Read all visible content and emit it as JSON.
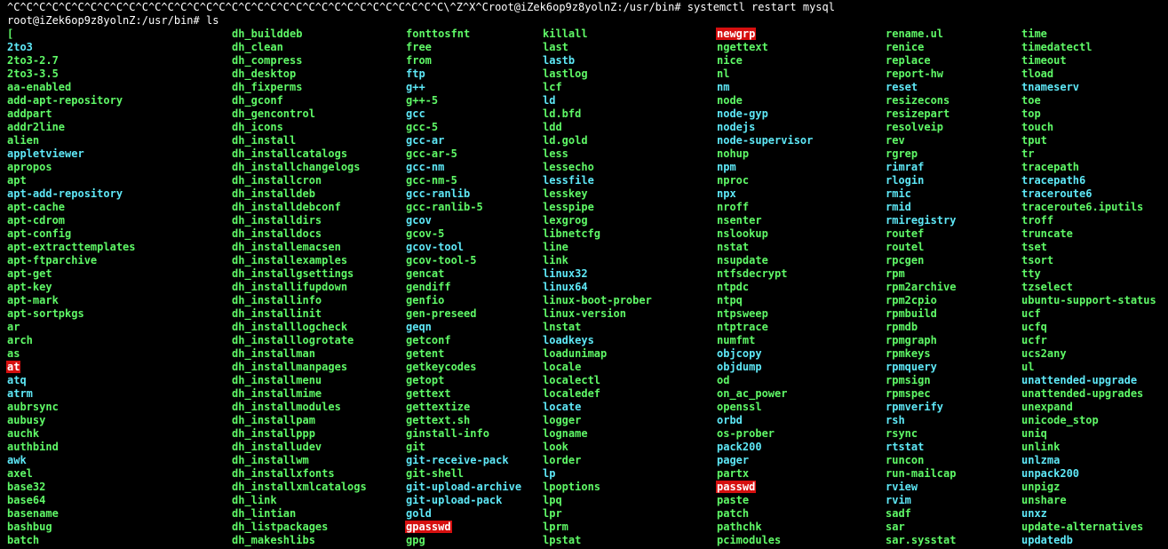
{
  "theme": {
    "background": "#000000",
    "text": "#ffffff",
    "executable": "#5ff967",
    "symlink": "#5ee8f7",
    "setuid_bg": "#d60f0f",
    "setuid_fg": "#ffffff"
  },
  "terminal": {
    "lines": [
      "^C^C^C^C^C^C^C^C^C^C^C^C^C^C^C^C^C^C^C^C^C^C^C^C^C^C^C^C^C^C^C^C^C^C\\^Z^X^Croot@iZek6op9z8yolnZ:/usr/bin# systemctl restart mysql",
      "root@iZek6op9z8yolnZ:/usr/bin# ls"
    ],
    "columns": [
      [
        {
          "n": "[",
          "t": "e"
        },
        {
          "n": "2to3",
          "t": "l"
        },
        {
          "n": "2to3-2.7",
          "t": "e"
        },
        {
          "n": "2to3-3.5",
          "t": "e"
        },
        {
          "n": "aa-enabled",
          "t": "e"
        },
        {
          "n": "add-apt-repository",
          "t": "e"
        },
        {
          "n": "addpart",
          "t": "e"
        },
        {
          "n": "addr2line",
          "t": "e"
        },
        {
          "n": "alien",
          "t": "e"
        },
        {
          "n": "appletviewer",
          "t": "l"
        },
        {
          "n": "apropos",
          "t": "e"
        },
        {
          "n": "apt",
          "t": "e"
        },
        {
          "n": "apt-add-repository",
          "t": "l"
        },
        {
          "n": "apt-cache",
          "t": "e"
        },
        {
          "n": "apt-cdrom",
          "t": "e"
        },
        {
          "n": "apt-config",
          "t": "e"
        },
        {
          "n": "apt-extracttemplates",
          "t": "e"
        },
        {
          "n": "apt-ftparchive",
          "t": "e"
        },
        {
          "n": "apt-get",
          "t": "e"
        },
        {
          "n": "apt-key",
          "t": "e"
        },
        {
          "n": "apt-mark",
          "t": "e"
        },
        {
          "n": "apt-sortpkgs",
          "t": "e"
        },
        {
          "n": "ar",
          "t": "e"
        },
        {
          "n": "arch",
          "t": "e"
        },
        {
          "n": "as",
          "t": "e"
        },
        {
          "n": "at",
          "t": "s"
        },
        {
          "n": "atq",
          "t": "l"
        },
        {
          "n": "atrm",
          "t": "l"
        },
        {
          "n": "aubrsync",
          "t": "e"
        },
        {
          "n": "aubusy",
          "t": "e"
        },
        {
          "n": "auchk",
          "t": "e"
        },
        {
          "n": "authbind",
          "t": "e"
        },
        {
          "n": "awk",
          "t": "l"
        },
        {
          "n": "axel",
          "t": "e"
        },
        {
          "n": "base32",
          "t": "e"
        },
        {
          "n": "base64",
          "t": "e"
        },
        {
          "n": "basename",
          "t": "e"
        },
        {
          "n": "bashbug",
          "t": "e"
        },
        {
          "n": "batch",
          "t": "e"
        }
      ],
      [
        {
          "n": "dh_builddeb",
          "t": "e"
        },
        {
          "n": "dh_clean",
          "t": "e"
        },
        {
          "n": "dh_compress",
          "t": "e"
        },
        {
          "n": "dh_desktop",
          "t": "e"
        },
        {
          "n": "dh_fixperms",
          "t": "e"
        },
        {
          "n": "dh_gconf",
          "t": "e"
        },
        {
          "n": "dh_gencontrol",
          "t": "e"
        },
        {
          "n": "dh_icons",
          "t": "e"
        },
        {
          "n": "dh_install",
          "t": "e"
        },
        {
          "n": "dh_installcatalogs",
          "t": "e"
        },
        {
          "n": "dh_installchangelogs",
          "t": "e"
        },
        {
          "n": "dh_installcron",
          "t": "e"
        },
        {
          "n": "dh_installdeb",
          "t": "e"
        },
        {
          "n": "dh_installdebconf",
          "t": "e"
        },
        {
          "n": "dh_installdirs",
          "t": "e"
        },
        {
          "n": "dh_installdocs",
          "t": "e"
        },
        {
          "n": "dh_installemacsen",
          "t": "e"
        },
        {
          "n": "dh_installexamples",
          "t": "e"
        },
        {
          "n": "dh_installgsettings",
          "t": "e"
        },
        {
          "n": "dh_installifupdown",
          "t": "e"
        },
        {
          "n": "dh_installinfo",
          "t": "e"
        },
        {
          "n": "dh_installinit",
          "t": "e"
        },
        {
          "n": "dh_installlogcheck",
          "t": "e"
        },
        {
          "n": "dh_installlogrotate",
          "t": "e"
        },
        {
          "n": "dh_installman",
          "t": "e"
        },
        {
          "n": "dh_installmanpages",
          "t": "e"
        },
        {
          "n": "dh_installmenu",
          "t": "e"
        },
        {
          "n": "dh_installmime",
          "t": "e"
        },
        {
          "n": "dh_installmodules",
          "t": "e"
        },
        {
          "n": "dh_installpam",
          "t": "e"
        },
        {
          "n": "dh_installppp",
          "t": "e"
        },
        {
          "n": "dh_installudev",
          "t": "e"
        },
        {
          "n": "dh_installwm",
          "t": "e"
        },
        {
          "n": "dh_installxfonts",
          "t": "e"
        },
        {
          "n": "dh_installxmlcatalogs",
          "t": "e"
        },
        {
          "n": "dh_link",
          "t": "e"
        },
        {
          "n": "dh_lintian",
          "t": "e"
        },
        {
          "n": "dh_listpackages",
          "t": "e"
        },
        {
          "n": "dh_makeshlibs",
          "t": "e"
        }
      ],
      [
        {
          "n": "fonttosfnt",
          "t": "e"
        },
        {
          "n": "free",
          "t": "e"
        },
        {
          "n": "from",
          "t": "e"
        },
        {
          "n": "ftp",
          "t": "l"
        },
        {
          "n": "g++",
          "t": "l"
        },
        {
          "n": "g++-5",
          "t": "e"
        },
        {
          "n": "gcc",
          "t": "l"
        },
        {
          "n": "gcc-5",
          "t": "e"
        },
        {
          "n": "gcc-ar",
          "t": "l"
        },
        {
          "n": "gcc-ar-5",
          "t": "e"
        },
        {
          "n": "gcc-nm",
          "t": "l"
        },
        {
          "n": "gcc-nm-5",
          "t": "e"
        },
        {
          "n": "gcc-ranlib",
          "t": "l"
        },
        {
          "n": "gcc-ranlib-5",
          "t": "e"
        },
        {
          "n": "gcov",
          "t": "l"
        },
        {
          "n": "gcov-5",
          "t": "e"
        },
        {
          "n": "gcov-tool",
          "t": "l"
        },
        {
          "n": "gcov-tool-5",
          "t": "e"
        },
        {
          "n": "gencat",
          "t": "e"
        },
        {
          "n": "gendiff",
          "t": "e"
        },
        {
          "n": "genfio",
          "t": "e"
        },
        {
          "n": "gen-preseed",
          "t": "e"
        },
        {
          "n": "geqn",
          "t": "l"
        },
        {
          "n": "getconf",
          "t": "e"
        },
        {
          "n": "getent",
          "t": "e"
        },
        {
          "n": "getkeycodes",
          "t": "e"
        },
        {
          "n": "getopt",
          "t": "e"
        },
        {
          "n": "gettext",
          "t": "e"
        },
        {
          "n": "gettextize",
          "t": "e"
        },
        {
          "n": "gettext.sh",
          "t": "e"
        },
        {
          "n": "ginstall-info",
          "t": "e"
        },
        {
          "n": "git",
          "t": "e"
        },
        {
          "n": "git-receive-pack",
          "t": "l"
        },
        {
          "n": "git-shell",
          "t": "e"
        },
        {
          "n": "git-upload-archive",
          "t": "l"
        },
        {
          "n": "git-upload-pack",
          "t": "l"
        },
        {
          "n": "gold",
          "t": "l"
        },
        {
          "n": "gpasswd",
          "t": "s"
        },
        {
          "n": "gpg",
          "t": "e"
        }
      ],
      [
        {
          "n": "killall",
          "t": "e"
        },
        {
          "n": "last",
          "t": "e"
        },
        {
          "n": "lastb",
          "t": "l"
        },
        {
          "n": "lastlog",
          "t": "e"
        },
        {
          "n": "lcf",
          "t": "e"
        },
        {
          "n": "ld",
          "t": "l"
        },
        {
          "n": "ld.bfd",
          "t": "e"
        },
        {
          "n": "ldd",
          "t": "e"
        },
        {
          "n": "ld.gold",
          "t": "e"
        },
        {
          "n": "less",
          "t": "e"
        },
        {
          "n": "lessecho",
          "t": "e"
        },
        {
          "n": "lessfile",
          "t": "l"
        },
        {
          "n": "lesskey",
          "t": "e"
        },
        {
          "n": "lesspipe",
          "t": "e"
        },
        {
          "n": "lexgrog",
          "t": "e"
        },
        {
          "n": "libnetcfg",
          "t": "e"
        },
        {
          "n": "line",
          "t": "e"
        },
        {
          "n": "link",
          "t": "e"
        },
        {
          "n": "linux32",
          "t": "l"
        },
        {
          "n": "linux64",
          "t": "l"
        },
        {
          "n": "linux-boot-prober",
          "t": "e"
        },
        {
          "n": "linux-version",
          "t": "e"
        },
        {
          "n": "lnstat",
          "t": "e"
        },
        {
          "n": "loadkeys",
          "t": "l"
        },
        {
          "n": "loadunimap",
          "t": "e"
        },
        {
          "n": "locale",
          "t": "e"
        },
        {
          "n": "localectl",
          "t": "e"
        },
        {
          "n": "localedef",
          "t": "e"
        },
        {
          "n": "locate",
          "t": "l"
        },
        {
          "n": "logger",
          "t": "e"
        },
        {
          "n": "logname",
          "t": "e"
        },
        {
          "n": "look",
          "t": "e"
        },
        {
          "n": "lorder",
          "t": "e"
        },
        {
          "n": "lp",
          "t": "l"
        },
        {
          "n": "lpoptions",
          "t": "e"
        },
        {
          "n": "lpq",
          "t": "e"
        },
        {
          "n": "lpr",
          "t": "e"
        },
        {
          "n": "lprm",
          "t": "e"
        },
        {
          "n": "lpstat",
          "t": "e"
        }
      ],
      [
        {
          "n": "newgrp",
          "t": "s"
        },
        {
          "n": "ngettext",
          "t": "e"
        },
        {
          "n": "nice",
          "t": "e"
        },
        {
          "n": "nl",
          "t": "e"
        },
        {
          "n": "nm",
          "t": "l"
        },
        {
          "n": "node",
          "t": "e"
        },
        {
          "n": "node-gyp",
          "t": "l"
        },
        {
          "n": "nodejs",
          "t": "l"
        },
        {
          "n": "node-supervisor",
          "t": "l"
        },
        {
          "n": "nohup",
          "t": "e"
        },
        {
          "n": "npm",
          "t": "l"
        },
        {
          "n": "nproc",
          "t": "e"
        },
        {
          "n": "npx",
          "t": "l"
        },
        {
          "n": "nroff",
          "t": "e"
        },
        {
          "n": "nsenter",
          "t": "e"
        },
        {
          "n": "nslookup",
          "t": "e"
        },
        {
          "n": "nstat",
          "t": "e"
        },
        {
          "n": "nsupdate",
          "t": "e"
        },
        {
          "n": "ntfsdecrypt",
          "t": "e"
        },
        {
          "n": "ntpdc",
          "t": "e"
        },
        {
          "n": "ntpq",
          "t": "e"
        },
        {
          "n": "ntpsweep",
          "t": "e"
        },
        {
          "n": "ntptrace",
          "t": "e"
        },
        {
          "n": "numfmt",
          "t": "e"
        },
        {
          "n": "objcopy",
          "t": "l"
        },
        {
          "n": "objdump",
          "t": "l"
        },
        {
          "n": "od",
          "t": "e"
        },
        {
          "n": "on_ac_power",
          "t": "e"
        },
        {
          "n": "openssl",
          "t": "e"
        },
        {
          "n": "orbd",
          "t": "l"
        },
        {
          "n": "os-prober",
          "t": "e"
        },
        {
          "n": "pack200",
          "t": "l"
        },
        {
          "n": "pager",
          "t": "l"
        },
        {
          "n": "partx",
          "t": "e"
        },
        {
          "n": "passwd",
          "t": "s"
        },
        {
          "n": "paste",
          "t": "e"
        },
        {
          "n": "patch",
          "t": "e"
        },
        {
          "n": "pathchk",
          "t": "e"
        },
        {
          "n": "pcimodules",
          "t": "e"
        }
      ],
      [
        {
          "n": "rename.ul",
          "t": "e"
        },
        {
          "n": "renice",
          "t": "e"
        },
        {
          "n": "replace",
          "t": "e"
        },
        {
          "n": "report-hw",
          "t": "e"
        },
        {
          "n": "reset",
          "t": "l"
        },
        {
          "n": "resizecons",
          "t": "e"
        },
        {
          "n": "resizepart",
          "t": "e"
        },
        {
          "n": "resolveip",
          "t": "e"
        },
        {
          "n": "rev",
          "t": "e"
        },
        {
          "n": "rgrep",
          "t": "e"
        },
        {
          "n": "rimraf",
          "t": "l"
        },
        {
          "n": "rlogin",
          "t": "l"
        },
        {
          "n": "rmic",
          "t": "l"
        },
        {
          "n": "rmid",
          "t": "l"
        },
        {
          "n": "rmiregistry",
          "t": "l"
        },
        {
          "n": "routef",
          "t": "e"
        },
        {
          "n": "routel",
          "t": "e"
        },
        {
          "n": "rpcgen",
          "t": "e"
        },
        {
          "n": "rpm",
          "t": "e"
        },
        {
          "n": "rpm2archive",
          "t": "e"
        },
        {
          "n": "rpm2cpio",
          "t": "e"
        },
        {
          "n": "rpmbuild",
          "t": "e"
        },
        {
          "n": "rpmdb",
          "t": "e"
        },
        {
          "n": "rpmgraph",
          "t": "e"
        },
        {
          "n": "rpmkeys",
          "t": "e"
        },
        {
          "n": "rpmquery",
          "t": "l"
        },
        {
          "n": "rpmsign",
          "t": "e"
        },
        {
          "n": "rpmspec",
          "t": "e"
        },
        {
          "n": "rpmverify",
          "t": "l"
        },
        {
          "n": "rsh",
          "t": "l"
        },
        {
          "n": "rsync",
          "t": "e"
        },
        {
          "n": "rtstat",
          "t": "l"
        },
        {
          "n": "runcon",
          "t": "e"
        },
        {
          "n": "run-mailcap",
          "t": "e"
        },
        {
          "n": "rview",
          "t": "l"
        },
        {
          "n": "rvim",
          "t": "l"
        },
        {
          "n": "sadf",
          "t": "e"
        },
        {
          "n": "sar",
          "t": "e"
        },
        {
          "n": "sar.sysstat",
          "t": "e"
        }
      ],
      [
        {
          "n": "time",
          "t": "e"
        },
        {
          "n": "timedatectl",
          "t": "e"
        },
        {
          "n": "timeout",
          "t": "e"
        },
        {
          "n": "tload",
          "t": "e"
        },
        {
          "n": "tnameserv",
          "t": "l"
        },
        {
          "n": "toe",
          "t": "e"
        },
        {
          "n": "top",
          "t": "e"
        },
        {
          "n": "touch",
          "t": "e"
        },
        {
          "n": "tput",
          "t": "e"
        },
        {
          "n": "tr",
          "t": "e"
        },
        {
          "n": "tracepath",
          "t": "e"
        },
        {
          "n": "tracepath6",
          "t": "l"
        },
        {
          "n": "traceroute6",
          "t": "l"
        },
        {
          "n": "traceroute6.iputils",
          "t": "e"
        },
        {
          "n": "troff",
          "t": "e"
        },
        {
          "n": "truncate",
          "t": "e"
        },
        {
          "n": "tset",
          "t": "e"
        },
        {
          "n": "tsort",
          "t": "e"
        },
        {
          "n": "tty",
          "t": "e"
        },
        {
          "n": "tzselect",
          "t": "e"
        },
        {
          "n": "ubuntu-support-status",
          "t": "e"
        },
        {
          "n": "ucf",
          "t": "e"
        },
        {
          "n": "ucfq",
          "t": "e"
        },
        {
          "n": "ucfr",
          "t": "e"
        },
        {
          "n": "ucs2any",
          "t": "e"
        },
        {
          "n": "ul",
          "t": "e"
        },
        {
          "n": "unattended-upgrade",
          "t": "l"
        },
        {
          "n": "unattended-upgrades",
          "t": "e"
        },
        {
          "n": "unexpand",
          "t": "e"
        },
        {
          "n": "unicode_stop",
          "t": "e"
        },
        {
          "n": "uniq",
          "t": "e"
        },
        {
          "n": "unlink",
          "t": "e"
        },
        {
          "n": "unlzma",
          "t": "l"
        },
        {
          "n": "unpack200",
          "t": "l"
        },
        {
          "n": "unpigz",
          "t": "e"
        },
        {
          "n": "unshare",
          "t": "e"
        },
        {
          "n": "unxz",
          "t": "l"
        },
        {
          "n": "update-alternatives",
          "t": "e"
        },
        {
          "n": "updatedb",
          "t": "l"
        }
      ]
    ]
  }
}
